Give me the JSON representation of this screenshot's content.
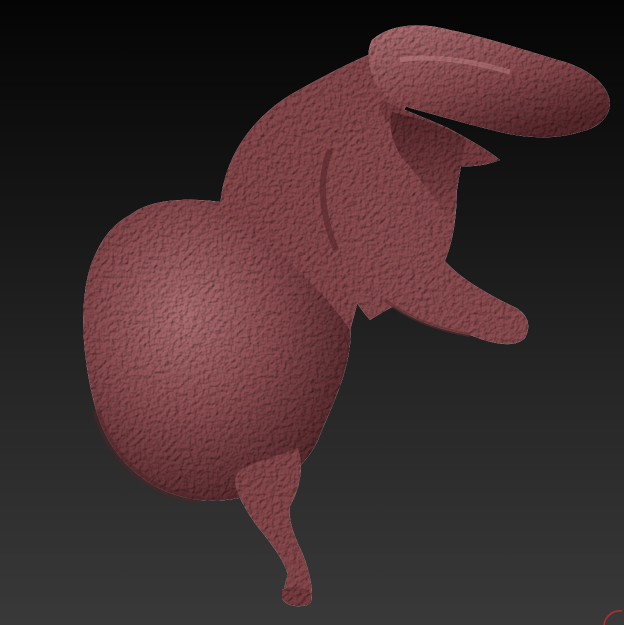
{
  "canvas": {
    "background_top": "#040404",
    "background_bottom": "#393939"
  },
  "model": {
    "subject": "sculpted-tyrannosaurus-torso",
    "material_color": "#8e4e52",
    "highlight_color": "#b77478",
    "shadow_color": "#4e2428"
  },
  "gizmo": {
    "icon": "orientation-arc-icon",
    "color": "#b0302c"
  }
}
